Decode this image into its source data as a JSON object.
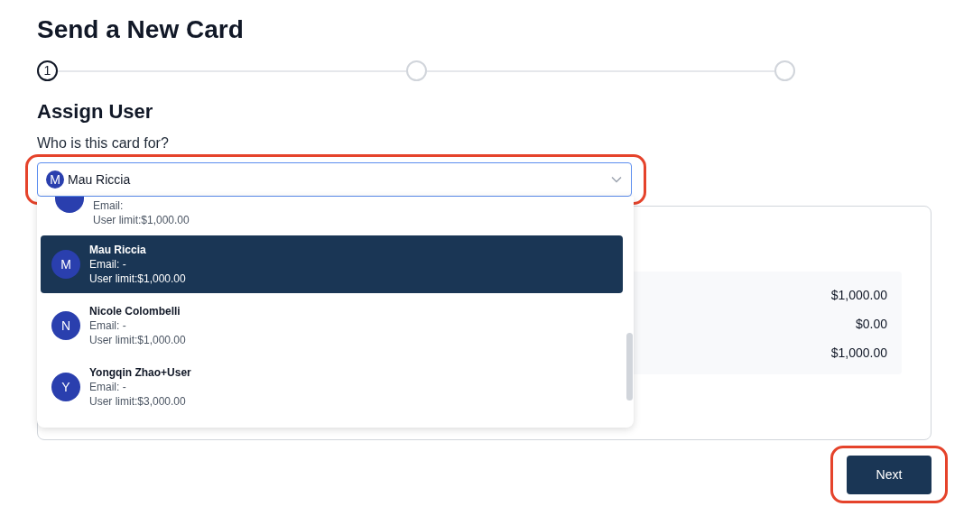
{
  "title": "Send a New Card",
  "stepper": [
    {
      "label": "1",
      "selected": true
    },
    {
      "selected": false
    },
    {
      "selected": false
    }
  ],
  "section_title": "Assign User",
  "field": {
    "label": "Who is this card for?",
    "avatar": "M",
    "value": "Mau Riccia",
    "outlined": true
  },
  "dropdown": {
    "options": [
      {
        "kind": "partial",
        "email": "Email:",
        "limit": "User limit:$1,000.00",
        "selected": false
      },
      {
        "kind": "full",
        "avatar": "M",
        "name": "Mau Riccia",
        "email": "Email: -",
        "limit": "User limit:$1,000.00",
        "selected": true
      },
      {
        "kind": "full",
        "avatar": "N",
        "name": "Nicole Colombelli",
        "email": "Email: -",
        "limit": "User limit:$1,000.00",
        "selected": false
      },
      {
        "kind": "full",
        "avatar": "Y",
        "name": "Yongqin Zhao+User",
        "email": "Email: -",
        "limit": "User limit:$3,000.00",
        "selected": false
      }
    ]
  },
  "summary": {
    "values": [
      "$1,000.00",
      "$0.00",
      "$1,000.00"
    ]
  },
  "next_button": {
    "label": "Next",
    "outlined": true
  }
}
